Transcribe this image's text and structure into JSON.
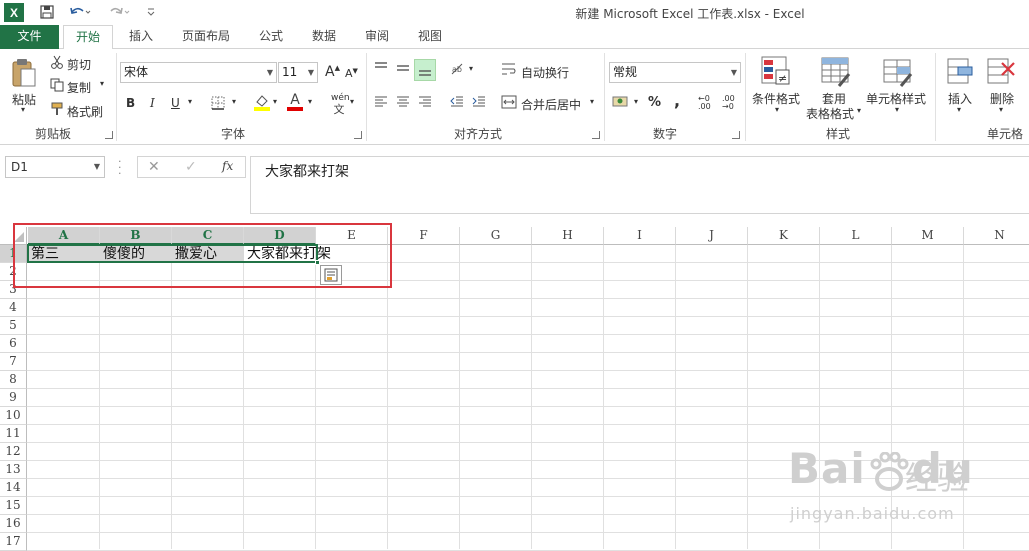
{
  "window": {
    "title": "新建 Microsoft Excel 工作表.xlsx - Excel",
    "logo": "X"
  },
  "tabs": [
    {
      "label": "文件"
    },
    {
      "label": "开始"
    },
    {
      "label": "插入"
    },
    {
      "label": "页面布局"
    },
    {
      "label": "公式"
    },
    {
      "label": "数据"
    },
    {
      "label": "审阅"
    },
    {
      "label": "视图"
    }
  ],
  "ribbon": {
    "clipboard": {
      "paste": "粘贴",
      "cut": "剪切",
      "copy": "复制",
      "format_painter": "格式刷",
      "label": "剪贴板"
    },
    "font": {
      "name": "宋体",
      "size": "11",
      "bold": "B",
      "italic": "I",
      "underline": "U",
      "grow": "A",
      "shrink": "A",
      "font_color": "A",
      "pinyin": "wén",
      "label": "字体"
    },
    "alignment": {
      "wrap_text": "自动换行",
      "merge_center": "合并后居中",
      "label": "对齐方式"
    },
    "number": {
      "format": "常规",
      "percent": "%",
      "comma": ",",
      "inc_decimal": "←0 .00",
      "dec_decimal": ".00 →0",
      "label": "数字"
    },
    "styles": {
      "conditional": "条件格式",
      "table_line1": "套用",
      "table_line2": "表格格式",
      "cell_styles": "单元格样式",
      "label": "样式"
    },
    "cells": {
      "insert": "插入",
      "delete": "删除",
      "label": "单元格"
    }
  },
  "formula_bar": {
    "name_box": "D1",
    "fx": "fx",
    "value": "大家都来打架"
  },
  "grid": {
    "columns": [
      "A",
      "B",
      "C",
      "D",
      "E",
      "F",
      "G",
      "H",
      "I",
      "J",
      "K",
      "L",
      "M",
      "N"
    ],
    "rows": [
      "1",
      "2",
      "3",
      "4",
      "5",
      "6",
      "7",
      "8",
      "9",
      "10",
      "11",
      "12",
      "13",
      "14",
      "15",
      "16",
      "17"
    ],
    "cells": {
      "A1": "第三",
      "B1": "傻傻的",
      "C1": "撒爱心",
      "D1": "大家都来打架"
    },
    "selected_range": "A1:D1",
    "active_cell": "D1"
  },
  "watermark": {
    "brand": "Bai",
    "brand2": "du",
    "product": "经验",
    "url": "jingyan.baidu.com"
  },
  "colors": {
    "accent": "#217346",
    "highlight_box": "#d9363e",
    "selection": "#d8d8d8"
  }
}
